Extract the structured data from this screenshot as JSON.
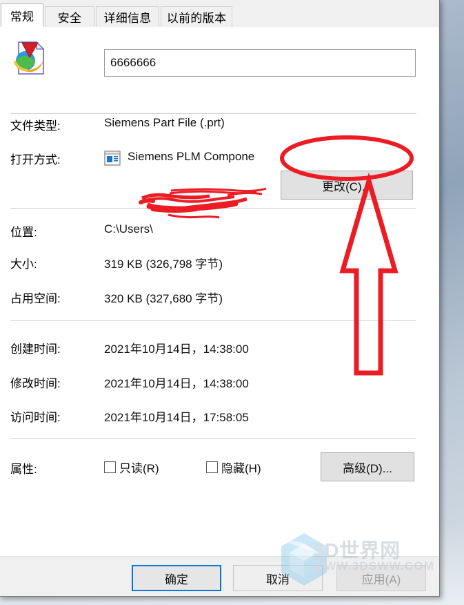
{
  "window": {
    "type": "file-properties-dialog"
  },
  "tabs": [
    {
      "label": "常规",
      "active": true
    },
    {
      "label": "安全",
      "active": false
    },
    {
      "label": "详细信息",
      "active": false
    },
    {
      "label": "以前的版本",
      "active": false
    }
  ],
  "header": {
    "icon": "downloaded-file-globe-icon",
    "filename_value": "6666666",
    "filename_placeholder": ""
  },
  "rows": {
    "filetype_label": "文件类型:",
    "filetype_value": "Siemens Part File (.prt)",
    "openwith_label": "打开方式:",
    "openwith_icon": "application-window-icon",
    "openwith_value": "Siemens PLM Compone",
    "change_button": "更改(C)...",
    "location_label": "位置:",
    "location_value": "C:\\Users\\",
    "size_label": "大小:",
    "size_value": "319 KB (326,798 字节)",
    "diskspace_label": "占用空间:",
    "diskspace_value": "320 KB (327,680 字节)",
    "created_label": "创建时间:",
    "created_value": "2021年10月14日，14:38:00",
    "modified_label": "修改时间:",
    "modified_value": "2021年10月14日，14:38:00",
    "accessed_label": "访问时间:",
    "accessed_value": "2021年10月14日，17:58:05",
    "attributes_label": "属性:",
    "readonly_label": "只读(R)",
    "readonly_checked": false,
    "hidden_label": "隐藏(H)",
    "hidden_checked": false,
    "advanced_button": "高级(D)..."
  },
  "footer": {
    "ok": "确定",
    "cancel": "取消",
    "apply": "应用(A)",
    "apply_disabled": true
  },
  "annotations": {
    "color": "#ec1c24",
    "circle_target": "更改(C)...",
    "arrow_direction": "up",
    "redaction": "location-path-scribble"
  },
  "watermark": {
    "brand": "3D世界网",
    "url": "WWW.3DSWW.COM",
    "logo": "cube-logo-icon"
  },
  "colors": {
    "accent": "#0078d7",
    "annotation_red": "#ec1c24",
    "dialog_bg": "#ffffff",
    "footer_bg": "#f0f0f0"
  }
}
